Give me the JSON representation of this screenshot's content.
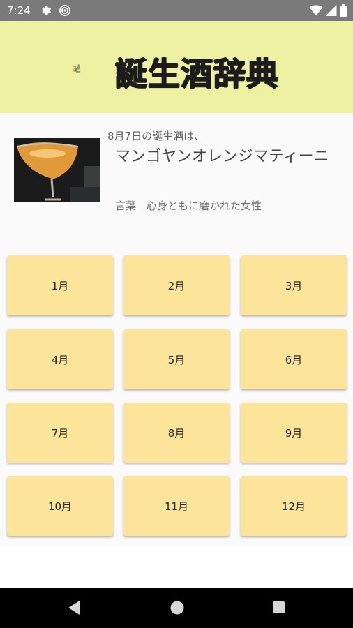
{
  "status_bar": {
    "time": "7:24"
  },
  "header": {
    "title": "誕生酒辞典"
  },
  "today": {
    "label": "8月7日の誕生酒は、",
    "drink_name": "マンゴヤンオレンジマティーニ",
    "word": "言葉　心身ともに磨かれた女性"
  },
  "months": [
    "1月",
    "2月",
    "3月",
    "4月",
    "5月",
    "6月",
    "7月",
    "8月",
    "9月",
    "10月",
    "11月",
    "12月"
  ],
  "colors": {
    "header_bg": "#eef0a2",
    "month_button": "#fde49b",
    "status_bar": "#7a7a7a"
  }
}
